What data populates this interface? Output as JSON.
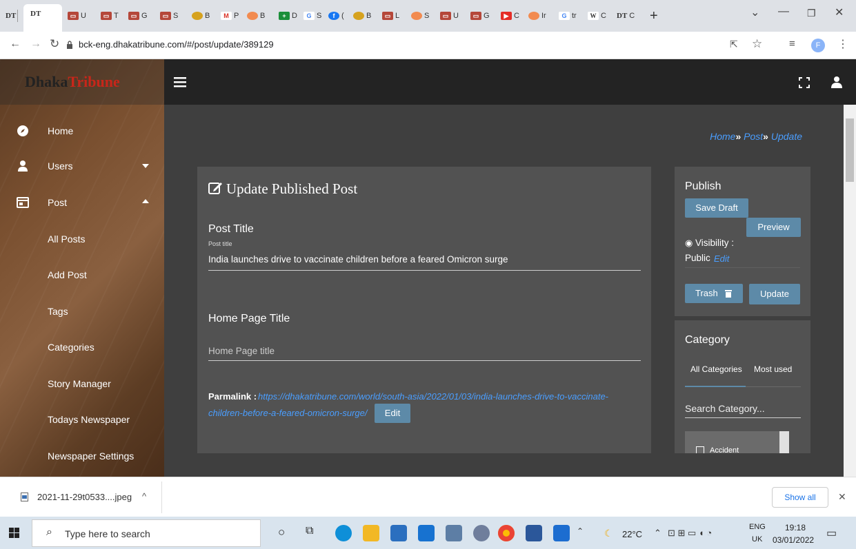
{
  "browser": {
    "tabs": [
      "DT",
      "DT",
      "U",
      "T",
      "G",
      "S",
      "B",
      "P",
      "B",
      "D",
      "S",
      "(",
      "B",
      "L",
      "S",
      "U",
      "G",
      "C",
      "Ir",
      "tr",
      "C",
      "C"
    ],
    "new_tab": "+",
    "url": "bck-eng.dhakatribune.com/#/post/update/389129"
  },
  "sidebar": {
    "logo_a": "Dhaka",
    "logo_b": "Tribune",
    "items": [
      {
        "label": "Home",
        "icon": "compass-icon"
      },
      {
        "label": "Users",
        "icon": "user-icon"
      },
      {
        "label": "Post",
        "icon": "post-icon"
      },
      {
        "label": "All Posts"
      },
      {
        "label": "Add Post"
      },
      {
        "label": "Tags"
      },
      {
        "label": "Categories"
      },
      {
        "label": "Story Manager"
      },
      {
        "label": "Todays Newspaper"
      },
      {
        "label": "Newspaper Settings"
      }
    ]
  },
  "breadcrumb": {
    "home": "Home",
    "post": "Post",
    "update": "Update",
    "sep": "»"
  },
  "form": {
    "heading": "Update Published Post",
    "post_title_label": "Post Title",
    "post_title_small": "Post title",
    "post_title_value": "India launches drive to vaccinate children before a feared Omicron surge",
    "home_title_label": "Home Page Title",
    "home_title_placeholder": "Home Page title",
    "permalink_label": "Parmalink :",
    "permalink_line1": "https://dhakatribune.com/world/south-asia/2022/01/03/india-launches-drive-to-vaccinate-",
    "permalink_line2": "children-before-a-feared-omicron-surge/",
    "edit_label": "Edit"
  },
  "publish": {
    "title": "Publish",
    "save_draft": "Save Draft",
    "preview": "Preview",
    "visibility_label": "Visibility :",
    "visibility_value": "Public",
    "visibility_edit": "Edit",
    "trash": "Trash",
    "update": "Update"
  },
  "category": {
    "title": "Category",
    "tab_all": "All Categories",
    "tab_used": "Most used",
    "search_placeholder": "Search Category...",
    "first_item": "Accident"
  },
  "downloads": {
    "file": "2021-11-29t0533....jpeg",
    "show_all": "Show all"
  },
  "taskbar": {
    "search": "Type here to search",
    "temp": "22°C",
    "lang1": "ENG",
    "lang2": "UK",
    "time": "19:18",
    "date": "03/01/2022"
  },
  "colors": {
    "accent": "#5d8aa8",
    "link": "#4a9eff",
    "panel": "#525252",
    "content_bg": "#3f3f3f"
  }
}
